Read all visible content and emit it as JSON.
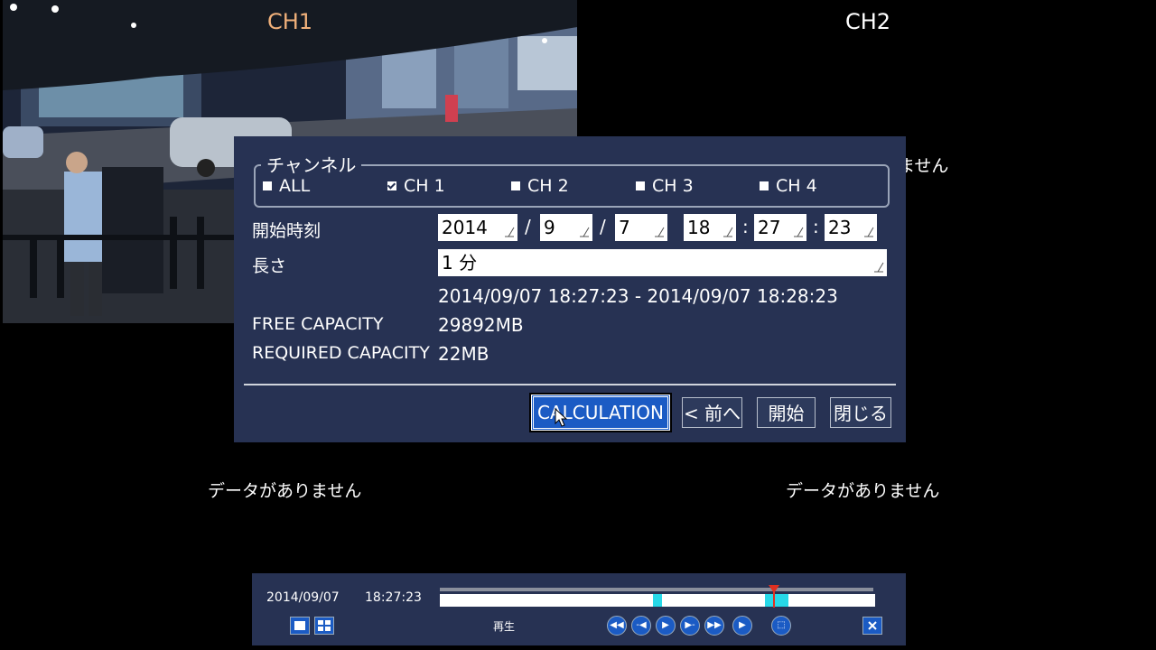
{
  "channels": {
    "ch1_label": "CH1",
    "ch2_label": "CH2",
    "no_data_text": "データがありません",
    "partial_no_data_text": "ません"
  },
  "dialog": {
    "channel_legend": "チャンネル",
    "channel_options": [
      {
        "label": "ALL",
        "checked": false
      },
      {
        "label": "CH 1",
        "checked": true
      },
      {
        "label": "CH 2",
        "checked": false
      },
      {
        "label": "CH 3",
        "checked": false
      },
      {
        "label": "CH 4",
        "checked": false
      }
    ],
    "start_time_label": "開始時刻",
    "start_time": {
      "year": "2014",
      "month": "9",
      "day": "7",
      "hour": "18",
      "minute": "27",
      "second": "23"
    },
    "date_sep": "/",
    "time_sep": ":",
    "length_label": "長さ",
    "length_value": "1 分",
    "range_text": "2014/09/07 18:27:23 - 2014/09/07 18:28:23",
    "free_capacity_label": "FREE CAPACITY",
    "free_capacity_value": "29892MB",
    "required_capacity_label": "REQUIRED CAPACITY",
    "required_capacity_value": "22MB",
    "buttons": {
      "calculation": "CALCULATION",
      "prev": "< 前へ",
      "start": "開始",
      "close": "閉じる"
    }
  },
  "playback": {
    "date": "2014/09/07",
    "time": "18:27:23",
    "status": "再生"
  },
  "colors": {
    "panel": "#273253",
    "accent": "#1b5bc4",
    "timeline_segment": "#27d8e8",
    "playhead": "#e03020",
    "ch1_label": "#f0b07a"
  }
}
